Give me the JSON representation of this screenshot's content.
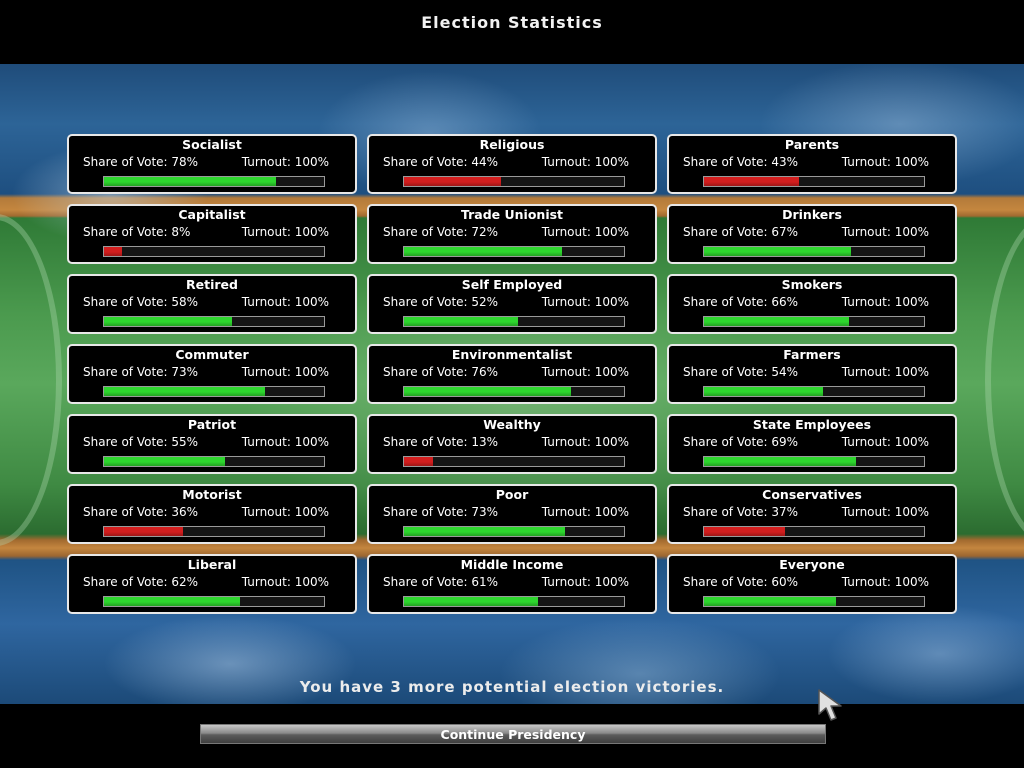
{
  "header": {
    "title": "Election Statistics"
  },
  "colors": {
    "good": "#2ed62e",
    "bad": "#d21e1e"
  },
  "labels": {
    "share_prefix": "Share of Vote: ",
    "turnout_prefix": "Turnout: "
  },
  "groups": [
    {
      "name": "Socialist",
      "share": "78%",
      "share_value": 78,
      "turnout": "100%",
      "status": "good"
    },
    {
      "name": "Religious",
      "share": "44%",
      "share_value": 44,
      "turnout": "100%",
      "status": "bad"
    },
    {
      "name": "Parents",
      "share": "43%",
      "share_value": 43,
      "turnout": "100%",
      "status": "bad"
    },
    {
      "name": "Capitalist",
      "share": "8%",
      "share_value": 8,
      "turnout": "100%",
      "status": "bad"
    },
    {
      "name": "Trade Unionist",
      "share": "72%",
      "share_value": 72,
      "turnout": "100%",
      "status": "good"
    },
    {
      "name": "Drinkers",
      "share": "67%",
      "share_value": 67,
      "turnout": "100%",
      "status": "good"
    },
    {
      "name": "Retired",
      "share": "58%",
      "share_value": 58,
      "turnout": "100%",
      "status": "good"
    },
    {
      "name": "Self Employed",
      "share": "52%",
      "share_value": 52,
      "turnout": "100%",
      "status": "good"
    },
    {
      "name": "Smokers",
      "share": "66%",
      "share_value": 66,
      "turnout": "100%",
      "status": "good"
    },
    {
      "name": "Commuter",
      "share": "73%",
      "share_value": 73,
      "turnout": "100%",
      "status": "good"
    },
    {
      "name": "Environmentalist",
      "share": "76%",
      "share_value": 76,
      "turnout": "100%",
      "status": "good"
    },
    {
      "name": "Farmers",
      "share": "54%",
      "share_value": 54,
      "turnout": "100%",
      "status": "good"
    },
    {
      "name": "Patriot",
      "share": "55%",
      "share_value": 55,
      "turnout": "100%",
      "status": "good"
    },
    {
      "name": "Wealthy",
      "share": "13%",
      "share_value": 13,
      "turnout": "100%",
      "status": "bad"
    },
    {
      "name": "State Employees",
      "share": "69%",
      "share_value": 69,
      "turnout": "100%",
      "status": "good"
    },
    {
      "name": "Motorist",
      "share": "36%",
      "share_value": 36,
      "turnout": "100%",
      "status": "bad"
    },
    {
      "name": "Poor",
      "share": "73%",
      "share_value": 73,
      "turnout": "100%",
      "status": "good"
    },
    {
      "name": "Conservatives",
      "share": "37%",
      "share_value": 37,
      "turnout": "100%",
      "status": "bad"
    },
    {
      "name": "Liberal",
      "share": "62%",
      "share_value": 62,
      "turnout": "100%",
      "status": "good"
    },
    {
      "name": "Middle Income",
      "share": "61%",
      "share_value": 61,
      "turnout": "100%",
      "status": "good"
    },
    {
      "name": "Everyone",
      "share": "60%",
      "share_value": 60,
      "turnout": "100%",
      "status": "good"
    }
  ],
  "footer": {
    "message": "You have 3 more potential election victories.",
    "continue_label": "Continue Presidency"
  },
  "icons": {
    "cursor": "mouse-pointer-icon"
  }
}
